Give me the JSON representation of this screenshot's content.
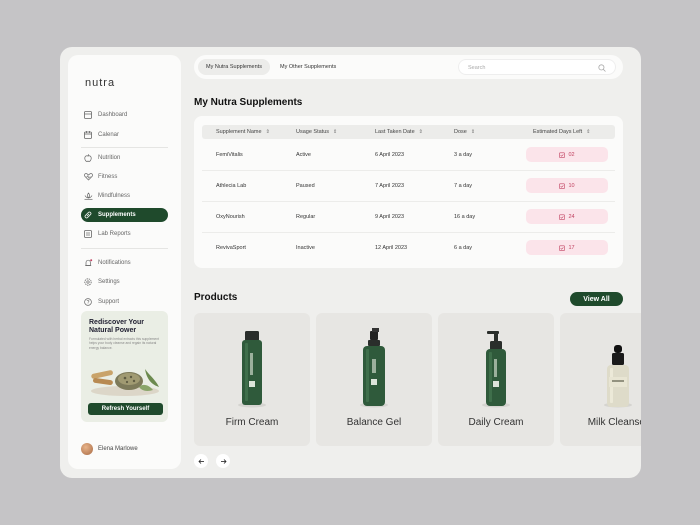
{
  "app": {
    "logo": "nutra"
  },
  "sidebar": {
    "items": [
      {
        "label": "Dashboard",
        "icon": "dashboard-icon"
      },
      {
        "label": "Calenar",
        "icon": "calendar-icon"
      },
      {
        "label": "Nutrition",
        "icon": "apple-icon"
      },
      {
        "label": "Fitness",
        "icon": "heartbeat-icon"
      },
      {
        "label": "Mindfulness",
        "icon": "lotus-icon"
      },
      {
        "label": "Supplements",
        "icon": "pill-icon",
        "active": true
      },
      {
        "label": "Lab Reports",
        "icon": "flask-icon"
      },
      {
        "label": "Notifications",
        "icon": "bell-icon"
      },
      {
        "label": "Settings",
        "icon": "gear-icon"
      },
      {
        "label": "Support",
        "icon": "help-icon"
      }
    ],
    "promo": {
      "title": "Rediscover Your Natural Power",
      "text": "Formulated with herbal extracts this supplement helps your body cleanse and regain its natural energy balance.",
      "button": "Refresh Yourself"
    },
    "user": {
      "name": "Elena Marlowe"
    }
  },
  "topbar": {
    "tabs": [
      "My Nutra Supplements",
      "My Other Supplements"
    ],
    "search_placeholder": "Search"
  },
  "supplements": {
    "title": "My Nutra Supplements",
    "columns": [
      "Supplement Name",
      "Usage Status",
      "Last Taken Date",
      "Dose",
      "Estimated Days Left"
    ],
    "rows": [
      {
        "name": "FemiVitalis",
        "status": "Active",
        "date": "6 April 2023",
        "dose": "3 a day",
        "days": "02"
      },
      {
        "name": "Athlecia Lab",
        "status": "Paused",
        "date": "7 April 2023",
        "dose": "7 a day",
        "days": "10"
      },
      {
        "name": "OxyNourish",
        "status": "Regular",
        "date": "9 April 2023",
        "dose": "16 a day",
        "days": "24"
      },
      {
        "name": "RevivaSport",
        "status": "Inactive",
        "date": "12 April 2023",
        "dose": "6 a day",
        "days": "17"
      }
    ]
  },
  "products": {
    "title": "Products",
    "view_all": "View All",
    "items": [
      {
        "name": "Firm Cream",
        "type": "tall-bottle"
      },
      {
        "name": "Balance Gel",
        "type": "spray-bottle"
      },
      {
        "name": "Daily Cream",
        "type": "pump-bottle"
      },
      {
        "name": "Milk Cleanser",
        "type": "dropper-bottle"
      }
    ]
  },
  "colors": {
    "accent": "#1f4a2c",
    "badge_bg": "#fbe4ea",
    "badge_text": "#c04060"
  }
}
